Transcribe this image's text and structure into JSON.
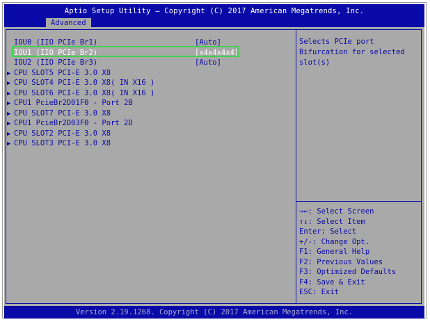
{
  "window": {
    "title": "Aptio Setup Utility – Copyright (C) 2017 American Megatrends, Inc.",
    "tab": "Advanced",
    "footer": "Version 2.19.1268. Copyright (C) 2017 American Megatrends, Inc."
  },
  "items": [
    {
      "label": "IOU0 (IIO PCIe Br1)",
      "value": "[Auto]",
      "submenu": false,
      "selected": false
    },
    {
      "label": "IOU1 (IIO PCIe Br2)",
      "value": "[x4x4x4x4]",
      "submenu": false,
      "selected": true
    },
    {
      "label": "IOU2 (IIO PCIe Br3)",
      "value": "[Auto]",
      "submenu": false,
      "selected": false
    },
    {
      "label": "CPU SLOT5 PCI-E 3.0 X8",
      "value": "",
      "submenu": true,
      "selected": false
    },
    {
      "label": "CPU SLOT4 PCI-E 3.0 X8( IN X16 )",
      "value": "",
      "submenu": true,
      "selected": false
    },
    {
      "label": "CPU SLOT6 PCI-E 3.0 X8( IN X16 )",
      "value": "",
      "submenu": true,
      "selected": false
    },
    {
      "label": "CPU1 PcieBr2D01F0 - Port 2B",
      "value": "",
      "submenu": true,
      "selected": false
    },
    {
      "label": "CPU SLOT7 PCI-E 3.0 X8",
      "value": "",
      "submenu": true,
      "selected": false
    },
    {
      "label": "CPU1 PcieBr2D03F0 - Port 2D",
      "value": "",
      "submenu": true,
      "selected": false
    },
    {
      "label": "CPU SLOT2 PCI-E 3.0 X8",
      "value": "",
      "submenu": true,
      "selected": false
    },
    {
      "label": "CPU SLOT3 PCI-E 3.0 X8",
      "value": "",
      "submenu": true,
      "selected": false
    }
  ],
  "help": {
    "text": "Selects PCIe port\nBifurcation for selected\nslot(s)"
  },
  "keys": [
    "→←: Select Screen",
    "↑↓: Select Item",
    "Enter: Select",
    "+/-: Change Opt.",
    "F1: General Help",
    "F2: Previous Values",
    "F3: Optimized Defaults",
    "F4: Save & Exit",
    "ESC: Exit"
  ],
  "icons": {
    "submenu": "triangle-right-icon"
  },
  "colors": {
    "header_blue": "#0a0aa8",
    "panel_gray": "#a9a9a9",
    "selected_text": "#ffffff",
    "highlight_green": "#3cd34a"
  }
}
